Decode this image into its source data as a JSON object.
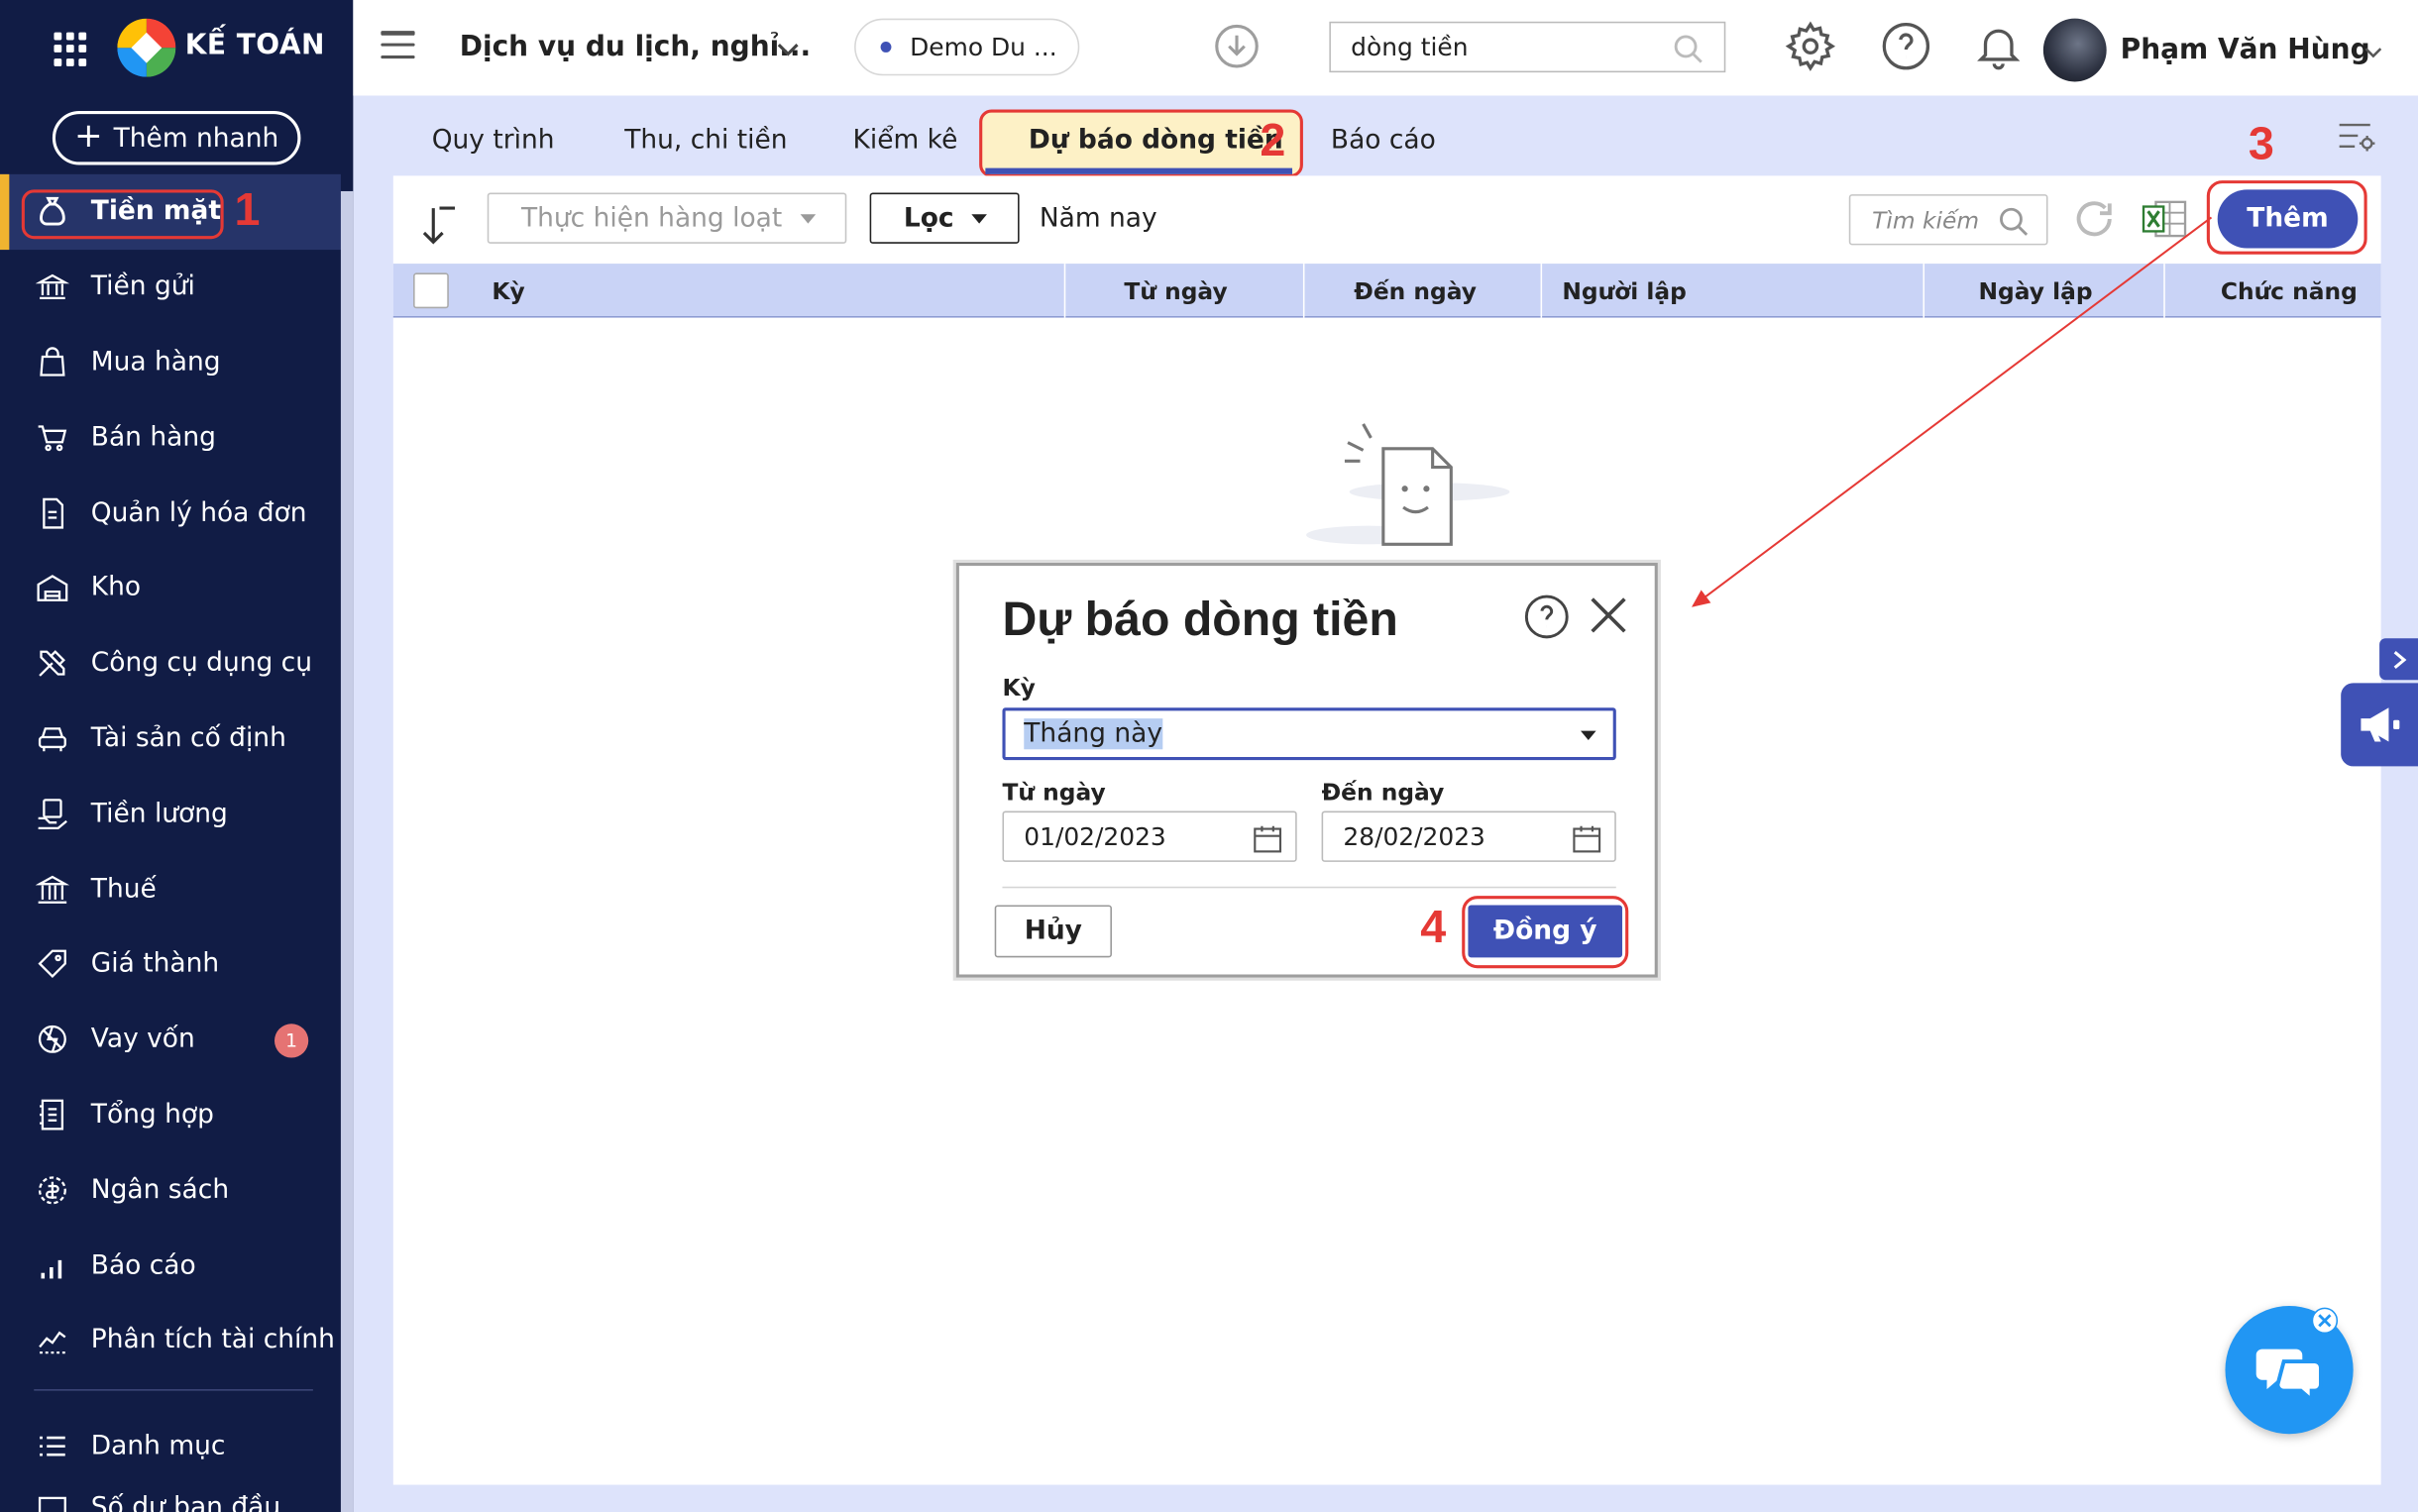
{
  "brand": {
    "name": "KẾ TOÁN"
  },
  "sidebar": {
    "quick_add": "Thêm nhanh",
    "items": [
      {
        "label": "Tiền mặt",
        "icon": "money-bag-icon",
        "active": true,
        "annotation": "1"
      },
      {
        "label": "Tiền gửi",
        "icon": "bank-icon"
      },
      {
        "label": "Mua hàng",
        "icon": "shopping-bag-icon"
      },
      {
        "label": "Bán hàng",
        "icon": "cart-icon"
      },
      {
        "label": "Quản lý hóa đơn",
        "icon": "invoice-icon"
      },
      {
        "label": "Kho",
        "icon": "warehouse-icon"
      },
      {
        "label": "Công cụ dụng cụ",
        "icon": "tools-icon"
      },
      {
        "label": "Tài sản cố định",
        "icon": "car-icon"
      },
      {
        "label": "Tiền lương",
        "icon": "salary-icon"
      },
      {
        "label": "Thuế",
        "icon": "tax-building-icon"
      },
      {
        "label": "Giá thành",
        "icon": "price-tag-icon"
      },
      {
        "label": "Vay vốn",
        "icon": "loan-icon",
        "badge": "1"
      },
      {
        "label": "Tổng hợp",
        "icon": "ledger-icon"
      },
      {
        "label": "Ngân sách",
        "icon": "budget-icon"
      },
      {
        "label": "Báo cáo",
        "icon": "bar-chart-icon"
      },
      {
        "label": "Phân tích tài chính",
        "icon": "line-chart-icon"
      }
    ],
    "bottom_items": [
      {
        "label": "Danh mục",
        "icon": "list-icon"
      },
      {
        "label": "Số dư ban đầu",
        "icon": "balance-icon"
      }
    ]
  },
  "header": {
    "company": "Dịch vụ du lịch, nghỉ...",
    "database": "Demo Du ...",
    "search_value": "dòng tiền",
    "user_name": "Phạm Văn Hùng"
  },
  "tabs": [
    {
      "label": "Quy trình"
    },
    {
      "label": "Thu, chi tiền"
    },
    {
      "label": "Kiểm kê"
    },
    {
      "label": "Dự báo dòng tiền",
      "active": true,
      "annotation": "2"
    },
    {
      "label": "Báo cáo"
    }
  ],
  "toolbar": {
    "bulk_action": "Thực hiện hàng loạt",
    "filter": "Lọc",
    "period": "Năm nay",
    "search_placeholder": "Tìm kiếm",
    "add_button": "Thêm",
    "add_annotation": "3"
  },
  "table": {
    "columns": [
      "Kỳ",
      "Từ ngày",
      "Đến ngày",
      "Người lập",
      "Ngày lập",
      "Chức năng"
    ]
  },
  "modal": {
    "title": "Dự báo dòng tiền",
    "period_label": "Kỳ",
    "period_value": "Tháng này",
    "from_label": "Từ ngày",
    "from_value": "01/02/2023",
    "to_label": "Đến ngày",
    "to_value": "28/02/2023",
    "cancel": "Hủy",
    "ok": "Đồng ý",
    "ok_annotation": "4"
  },
  "colors": {
    "sidebar_bg": "#111c45",
    "primary": "#3f51b5",
    "annotation": "#e53935",
    "tab_bar_bg": "#dde3fb",
    "table_header_bg": "#c9d3f6",
    "active_tab_bg": "#fdf1c6"
  }
}
